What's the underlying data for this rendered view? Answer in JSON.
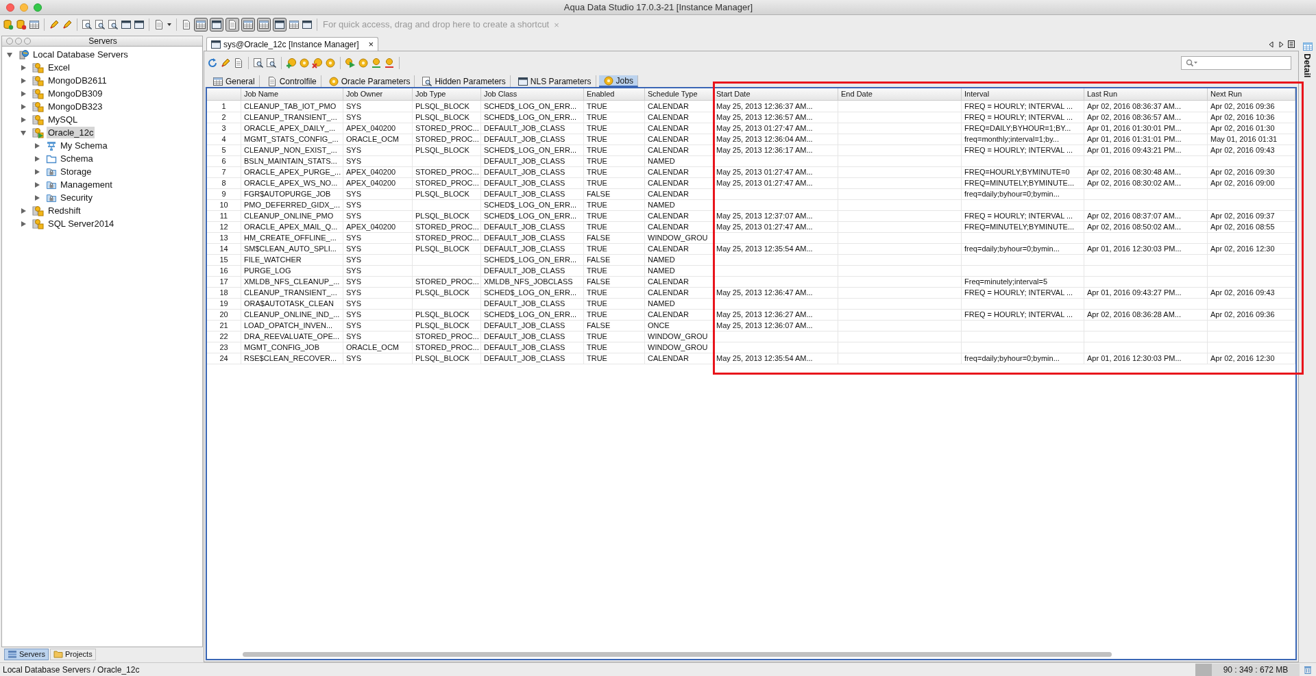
{
  "window": {
    "title": "Aqua Data Studio 17.0.3-21 [Instance Manager]"
  },
  "quick_access": {
    "hint": "For quick access, drag and drop here to create a shortcut",
    "close": "×"
  },
  "sidebar": {
    "title": "Servers",
    "tree": [
      {
        "label": "Local Database Servers",
        "kind": "root",
        "expanded": true,
        "selected": false,
        "children": [
          {
            "label": "Excel",
            "kind": "server",
            "expanded": false,
            "selected": false,
            "connected": false
          },
          {
            "label": "MongoDB2611",
            "kind": "server",
            "expanded": false,
            "selected": false,
            "connected": false
          },
          {
            "label": "MongoDB309",
            "kind": "server",
            "expanded": false,
            "selected": false,
            "connected": false
          },
          {
            "label": "MongoDB323",
            "kind": "server",
            "expanded": false,
            "selected": false,
            "connected": false
          },
          {
            "label": "MySQL",
            "kind": "server",
            "expanded": false,
            "selected": false,
            "connected": false
          },
          {
            "label": "Oracle_12c",
            "kind": "server",
            "expanded": true,
            "selected": true,
            "connected": true,
            "children": [
              {
                "label": "My Schema",
                "kind": "schema-tree",
                "expanded": false,
                "selected": false
              },
              {
                "label": "Schema",
                "kind": "folder",
                "expanded": false,
                "selected": false
              },
              {
                "label": "Storage",
                "kind": "locked-folder",
                "expanded": false,
                "selected": false
              },
              {
                "label": "Management",
                "kind": "locked-folder",
                "expanded": false,
                "selected": false
              },
              {
                "label": "Security",
                "kind": "locked-folder",
                "expanded": false,
                "selected": false
              }
            ]
          },
          {
            "label": "Redshift",
            "kind": "server",
            "expanded": false,
            "selected": false,
            "connected": false
          },
          {
            "label": "SQL Server2014",
            "kind": "server",
            "expanded": false,
            "selected": false,
            "connected": false
          }
        ]
      }
    ],
    "bottom_tabs": [
      {
        "label": "Servers",
        "selected": true
      },
      {
        "label": "Projects",
        "selected": false
      }
    ]
  },
  "editor_tab": {
    "label": "sys@Oracle_12c [Instance Manager]",
    "close": "×"
  },
  "detail_label": "Detail",
  "subtabs": [
    {
      "label": "General",
      "selected": false
    },
    {
      "label": "Controlfile",
      "selected": false
    },
    {
      "label": "Oracle Parameters",
      "selected": false
    },
    {
      "label": "Hidden Parameters",
      "selected": false
    },
    {
      "label": "NLS Parameters",
      "selected": false
    },
    {
      "label": "Jobs",
      "selected": true
    }
  ],
  "table": {
    "columns": [
      "Job Name",
      "Job Owner",
      "Job Type",
      "Job Class",
      "Enabled",
      "Schedule Type",
      "Start Date",
      "End Date",
      "Interval",
      "Last Run",
      "Next Run"
    ],
    "rows": [
      {
        "number": "1",
        "cells": [
          "CLEANUP_TAB_IOT_PMO",
          "SYS",
          "PLSQL_BLOCK",
          "SCHED$_LOG_ON_ERR...",
          "TRUE",
          "CALENDAR",
          "May 25, 2013 12:36:37 AM...",
          null,
          "FREQ = HOURLY; INTERVAL ...",
          "Apr 02, 2016 08:36:37 AM...",
          "Apr 02, 2016 09:36"
        ]
      },
      {
        "number": "2",
        "cells": [
          "CLEANUP_TRANSIENT_...",
          "SYS",
          "PLSQL_BLOCK",
          "SCHED$_LOG_ON_ERR...",
          "TRUE",
          "CALENDAR",
          "May 25, 2013 12:36:57 AM...",
          null,
          "FREQ = HOURLY; INTERVAL ...",
          "Apr 02, 2016 08:36:57 AM...",
          "Apr 02, 2016 10:36"
        ]
      },
      {
        "number": "3",
        "cells": [
          "ORACLE_APEX_DAILY_...",
          "APEX_040200",
          "STORED_PROC...",
          "DEFAULT_JOB_CLASS",
          "TRUE",
          "CALENDAR",
          "May 25, 2013 01:27:47 AM...",
          null,
          "FREQ=DAILY;BYHOUR=1;BY...",
          "Apr 01, 2016 01:30:01 PM...",
          "Apr 02, 2016 01:30"
        ]
      },
      {
        "number": "4",
        "cells": [
          "MGMT_STATS_CONFIG_...",
          "ORACLE_OCM",
          "STORED_PROC...",
          "DEFAULT_JOB_CLASS",
          "TRUE",
          "CALENDAR",
          "May 25, 2013 12:36:04 AM...",
          null,
          "freq=monthly;interval=1;by...",
          "Apr 01, 2016 01:31:01 PM...",
          "May 01, 2016 01:31"
        ]
      },
      {
        "number": "5",
        "cells": [
          "CLEANUP_NON_EXIST_...",
          "SYS",
          "PLSQL_BLOCK",
          "SCHED$_LOG_ON_ERR...",
          "TRUE",
          "CALENDAR",
          "May 25, 2013 12:36:17 AM...",
          null,
          "FREQ = HOURLY; INTERVAL ...",
          "Apr 01, 2016 09:43:21 PM...",
          "Apr 02, 2016 09:43"
        ]
      },
      {
        "number": "6",
        "cells": [
          "BSLN_MAINTAIN_STATS...",
          "SYS",
          null,
          "DEFAULT_JOB_CLASS",
          "TRUE",
          "NAMED",
          null,
          null,
          null,
          null,
          null
        ]
      },
      {
        "number": "7",
        "cells": [
          "ORACLE_APEX_PURGE_...",
          "APEX_040200",
          "STORED_PROC...",
          "DEFAULT_JOB_CLASS",
          "TRUE",
          "CALENDAR",
          "May 25, 2013 01:27:47 AM...",
          null,
          "FREQ=HOURLY;BYMINUTE=0",
          "Apr 02, 2016 08:30:48 AM...",
          "Apr 02, 2016 09:30"
        ]
      },
      {
        "number": "8",
        "cells": [
          "ORACLE_APEX_WS_NO...",
          "APEX_040200",
          "STORED_PROC...",
          "DEFAULT_JOB_CLASS",
          "TRUE",
          "CALENDAR",
          "May 25, 2013 01:27:47 AM...",
          null,
          "FREQ=MINUTELY;BYMINUTE...",
          "Apr 02, 2016 08:30:02 AM...",
          "Apr 02, 2016 09:00"
        ]
      },
      {
        "number": "9",
        "cells": [
          "FGR$AUTOPURGE_JOB",
          "SYS",
          "PLSQL_BLOCK",
          "DEFAULT_JOB_CLASS",
          "FALSE",
          "CALENDAR",
          null,
          null,
          "freq=daily;byhour=0;bymin...",
          null,
          null
        ]
      },
      {
        "number": "10",
        "cells": [
          "PMO_DEFERRED_GIDX_...",
          "SYS",
          null,
          "SCHED$_LOG_ON_ERR...",
          "TRUE",
          "NAMED",
          null,
          null,
          null,
          null,
          null
        ]
      },
      {
        "number": "11",
        "cells": [
          "CLEANUP_ONLINE_PMO",
          "SYS",
          "PLSQL_BLOCK",
          "SCHED$_LOG_ON_ERR...",
          "TRUE",
          "CALENDAR",
          "May 25, 2013 12:37:07 AM...",
          null,
          "FREQ = HOURLY; INTERVAL ...",
          "Apr 02, 2016 08:37:07 AM...",
          "Apr 02, 2016 09:37"
        ]
      },
      {
        "number": "12",
        "cells": [
          "ORACLE_APEX_MAIL_Q...",
          "APEX_040200",
          "STORED_PROC...",
          "DEFAULT_JOB_CLASS",
          "TRUE",
          "CALENDAR",
          "May 25, 2013 01:27:47 AM...",
          null,
          "FREQ=MINUTELY;BYMINUTE...",
          "Apr 02, 2016 08:50:02 AM...",
          "Apr 02, 2016 08:55"
        ]
      },
      {
        "number": "13",
        "cells": [
          "HM_CREATE_OFFLINE_...",
          "SYS",
          "STORED_PROC...",
          "DEFAULT_JOB_CLASS",
          "FALSE",
          "WINDOW_GROU",
          null,
          null,
          null,
          null,
          null
        ]
      },
      {
        "number": "14",
        "cells": [
          "SM$CLEAN_AUTO_SPLI...",
          "SYS",
          "PLSQL_BLOCK",
          "DEFAULT_JOB_CLASS",
          "TRUE",
          "CALENDAR",
          "May 25, 2013 12:35:54 AM...",
          null,
          "freq=daily;byhour=0;bymin...",
          "Apr 01, 2016 12:30:03 PM...",
          "Apr 02, 2016 12:30"
        ]
      },
      {
        "number": "15",
        "cells": [
          "FILE_WATCHER",
          "SYS",
          null,
          "SCHED$_LOG_ON_ERR...",
          "FALSE",
          "NAMED",
          null,
          null,
          null,
          null,
          null
        ]
      },
      {
        "number": "16",
        "cells": [
          "PURGE_LOG",
          "SYS",
          null,
          "DEFAULT_JOB_CLASS",
          "TRUE",
          "NAMED",
          null,
          null,
          null,
          null,
          null
        ]
      },
      {
        "number": "17",
        "cells": [
          "XMLDB_NFS_CLEANUP_...",
          "SYS",
          "STORED_PROC...",
          "XMLDB_NFS_JOBCLASS",
          "FALSE",
          "CALENDAR",
          null,
          null,
          "Freq=minutely;interval=5",
          null,
          null
        ]
      },
      {
        "number": "18",
        "cells": [
          "CLEANUP_TRANSIENT_...",
          "SYS",
          "PLSQL_BLOCK",
          "SCHED$_LOG_ON_ERR...",
          "TRUE",
          "CALENDAR",
          "May 25, 2013 12:36:47 AM...",
          null,
          "FREQ = HOURLY; INTERVAL ...",
          "Apr 01, 2016 09:43:27 PM...",
          "Apr 02, 2016 09:43"
        ]
      },
      {
        "number": "19",
        "cells": [
          "ORA$AUTOTASK_CLEAN",
          "SYS",
          null,
          "DEFAULT_JOB_CLASS",
          "TRUE",
          "NAMED",
          null,
          null,
          null,
          null,
          null
        ]
      },
      {
        "number": "20",
        "cells": [
          "CLEANUP_ONLINE_IND_...",
          "SYS",
          "PLSQL_BLOCK",
          "SCHED$_LOG_ON_ERR...",
          "TRUE",
          "CALENDAR",
          "May 25, 2013 12:36:27 AM...",
          null,
          "FREQ = HOURLY; INTERVAL ...",
          "Apr 02, 2016 08:36:28 AM...",
          "Apr 02, 2016 09:36"
        ]
      },
      {
        "number": "21",
        "cells": [
          "LOAD_OPATCH_INVEN...",
          "SYS",
          "PLSQL_BLOCK",
          "DEFAULT_JOB_CLASS",
          "FALSE",
          "ONCE",
          "May 25, 2013 12:36:07 AM...",
          null,
          null,
          null,
          null
        ]
      },
      {
        "number": "22",
        "cells": [
          "DRA_REEVALUATE_OPE...",
          "SYS",
          "STORED_PROC...",
          "DEFAULT_JOB_CLASS",
          "TRUE",
          "WINDOW_GROU",
          null,
          null,
          null,
          null,
          null
        ]
      },
      {
        "number": "23",
        "cells": [
          "MGMT_CONFIG_JOB",
          "ORACLE_OCM",
          "STORED_PROC...",
          "DEFAULT_JOB_CLASS",
          "TRUE",
          "WINDOW_GROU",
          null,
          null,
          null,
          null,
          null
        ]
      },
      {
        "number": "24",
        "cells": [
          "RSE$CLEAN_RECOVER...",
          "SYS",
          "PLSQL_BLOCK",
          "DEFAULT_JOB_CLASS",
          "TRUE",
          "CALENDAR",
          "May 25, 2013 12:35:54 AM...",
          null,
          "freq=daily;byhour=0;bymin...",
          "Apr 01, 2016 12:30:03 PM...",
          "Apr 02, 2016 12:30"
        ]
      }
    ]
  },
  "status_bar": {
    "path": "Local Database Servers / Oracle_12c",
    "memory": "90 : 349 : 672 MB"
  }
}
